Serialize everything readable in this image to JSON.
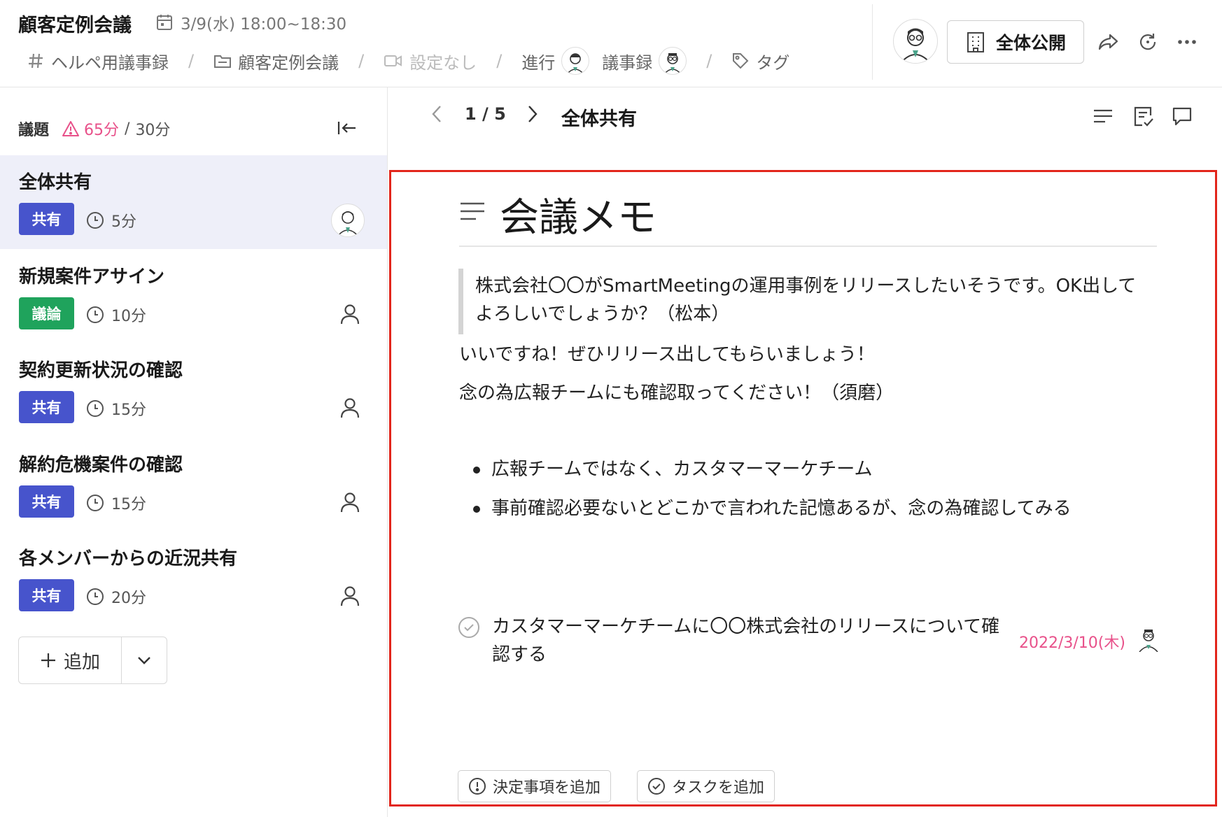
{
  "header": {
    "meeting_title": "顧客定例会議",
    "date_time": "3/9(水) 18:00~18:30",
    "breadcrumbs": {
      "channel": "ヘルペ用議事録",
      "folder": "顧客定例会議",
      "video": "設定なし",
      "facilitator_label": "進行",
      "minutes_label": "議事録",
      "tag": "タグ"
    },
    "publish_label": "全体公開"
  },
  "sidebar": {
    "agenda_label": "議題",
    "over_time": "65分",
    "slash": "/",
    "total_time": "30分",
    "items": [
      {
        "title": "全体共有",
        "badge": "共有",
        "duration": "5分"
      },
      {
        "title": "新規案件アサイン",
        "badge": "議論",
        "duration": "10分"
      },
      {
        "title": "契約更新状況の確認",
        "badge": "共有",
        "duration": "15分"
      },
      {
        "title": "解約危機案件の確認",
        "badge": "共有",
        "duration": "15分"
      },
      {
        "title": "各メンバーからの近況共有",
        "badge": "共有",
        "duration": "20分"
      }
    ],
    "add_label": "追加"
  },
  "main": {
    "page_counter": "1 / 5",
    "section_title": "全体共有",
    "memo": {
      "heading": "会議メモ",
      "quote": "株式会社〇〇がSmartMeetingの運用事例をリリースしたいそうです。OK出してよろしいでしょうか？（松本）",
      "para1": "いいですね！ぜひリリース出してもらいましょう！",
      "para2": "念の為広報チームにも確認取ってください！（須磨）",
      "bullets": [
        "広報チームではなく、カスタマーマーケチーム",
        "事前確認必要ないとどこかで言われた記憶あるが、念の為確認してみる"
      ],
      "task": {
        "text": "カスタマーマーケチームに〇〇株式会社のリリースについて確認する",
        "due": "2022/3/10(木)"
      },
      "add_decision_label": "決定事項を追加",
      "add_task_label": "タスクを追加"
    }
  },
  "colors": {
    "accent_share": "#4754cc",
    "accent_discuss": "#1fa35c",
    "warning_pink": "#e8518a",
    "highlight_border": "#e2261c",
    "active_row_bg": "#eeeff9"
  },
  "icons": [
    "calendar-icon",
    "hash-icon",
    "folder-icon",
    "video-icon",
    "tag-icon",
    "building-icon",
    "share-icon",
    "refresh-icon",
    "more-icon",
    "warning-icon",
    "collapse-sidebar-icon",
    "clock-icon",
    "user-icon",
    "plus-icon",
    "chevron-down-icon",
    "chevron-left-icon",
    "chevron-right-icon",
    "outline-icon",
    "notes-icon",
    "comment-icon",
    "check-circle-icon",
    "alert-circle-icon"
  ]
}
